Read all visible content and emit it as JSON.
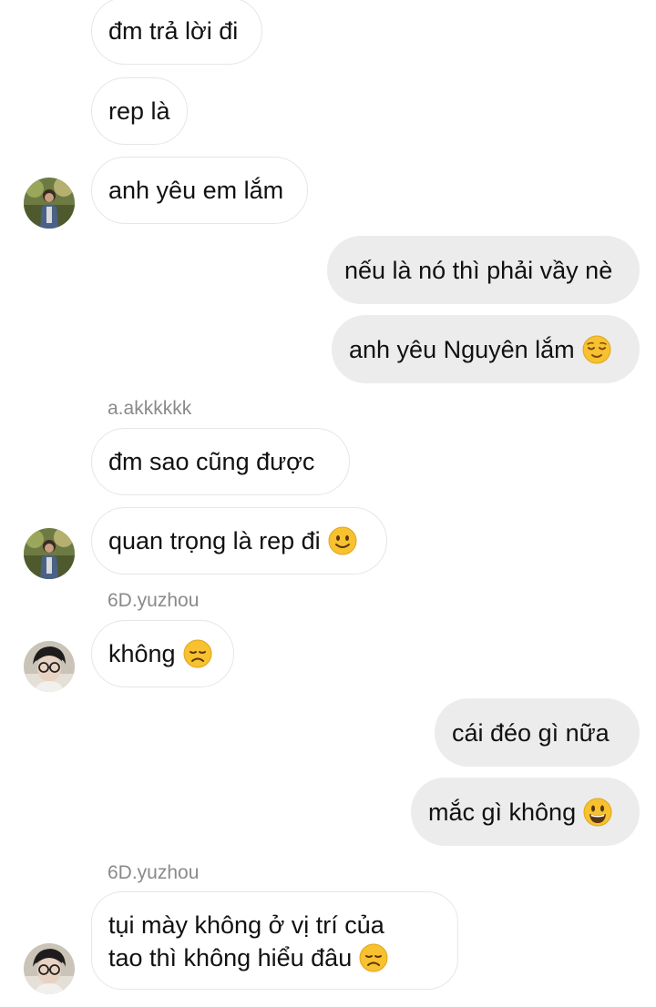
{
  "messages": [
    {
      "text": "đm trả lời đi"
    },
    {
      "text": "rep là"
    },
    {
      "text": "anh yêu em lắm"
    },
    {
      "text": "nếu là nó thì phải vầy nè"
    },
    {
      "text": "anh yêu Nguyên lắm",
      "emoji": "relieved-face"
    },
    {
      "sender": "a.akkkkkk",
      "text": "đm sao cũng được"
    },
    {
      "text": "quan trọng là rep đi",
      "emoji": "slightly-smiling-face"
    },
    {
      "sender": "6D.yuzhou",
      "text": "không",
      "emoji": "disappointed-face"
    },
    {
      "text": "cái đéo gì nữa"
    },
    {
      "text": "mắc gì không",
      "emoji": "grinning-face"
    },
    {
      "sender": "6D.yuzhou",
      "text_line1": "tụi mày không ở vị trí của",
      "text_line2": "tao thì không hiểu đâu",
      "emoji": "disappointed-face"
    }
  ],
  "colors": {
    "incoming_bubble": "#ffffff",
    "incoming_border": "#e6e6e6",
    "outgoing_bubble": "#ececec",
    "sender_name": "#8a8a8a",
    "emoji_yellow": "#f7c12f"
  }
}
